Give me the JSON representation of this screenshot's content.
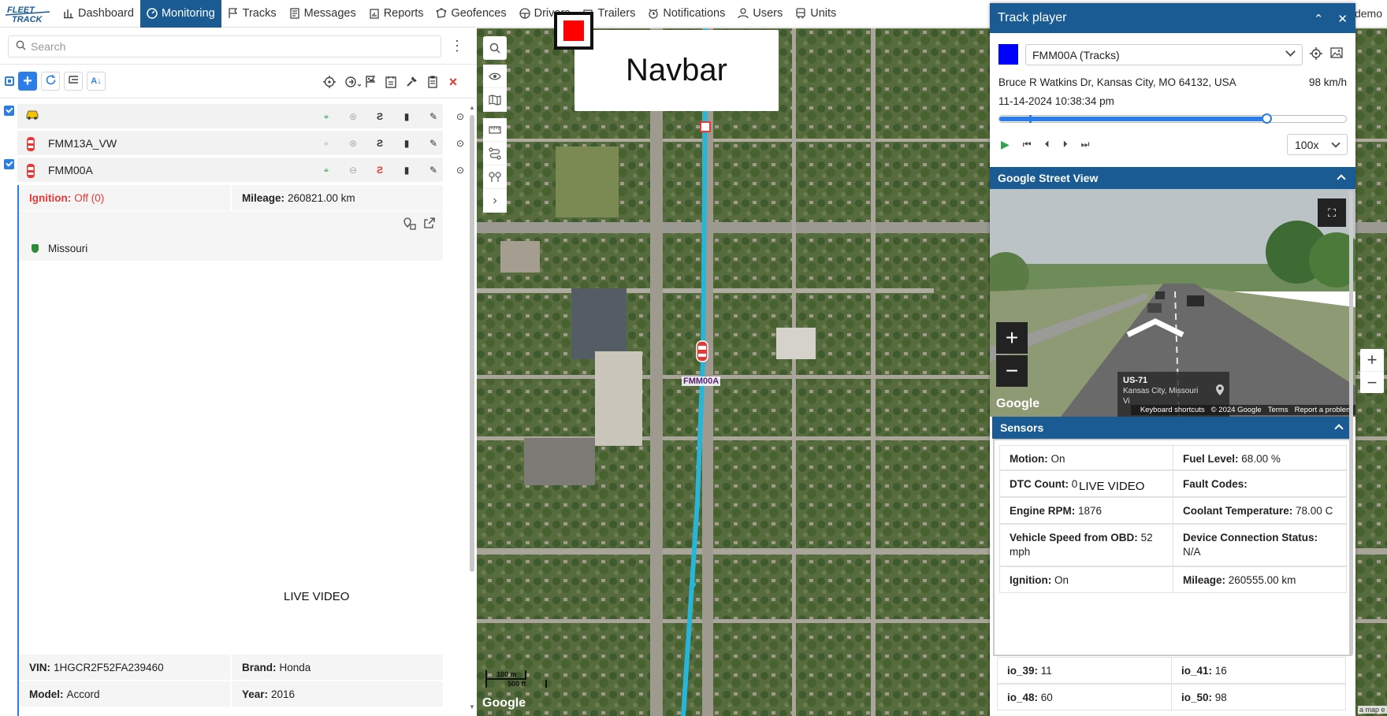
{
  "navbar": {
    "items": [
      {
        "label": "Dashboard",
        "icon": "bar-chart-icon"
      },
      {
        "label": "Monitoring",
        "icon": "gauge-icon",
        "active": true
      },
      {
        "label": "Tracks",
        "icon": "flag-icon"
      },
      {
        "label": "Messages",
        "icon": "document-icon"
      },
      {
        "label": "Reports",
        "icon": "report-icon"
      },
      {
        "label": "Geofences",
        "icon": "geofence-icon"
      },
      {
        "label": "Drivers",
        "icon": "steering-wheel-icon"
      },
      {
        "label": "Trailers",
        "icon": "trailer-icon"
      },
      {
        "label": "Notifications",
        "icon": "alarm-icon"
      },
      {
        "label": "Users",
        "icon": "user-icon"
      },
      {
        "label": "Units",
        "icon": "bus-icon"
      }
    ],
    "user": "_demo",
    "active_color": "#1a5b94"
  },
  "search": {
    "placeholder": "Search"
  },
  "units": [
    {
      "name": "",
      "checked": true,
      "icon": "taxi-icon"
    },
    {
      "name": "FMM13A_VW",
      "checked": false,
      "icon": "car-icon"
    },
    {
      "name": "FMM00A",
      "checked": true,
      "icon": "car-icon"
    }
  ],
  "unit_details": {
    "ignition_label": "Ignition:",
    "ignition_value": "Off (0)",
    "mileage_label": "Mileage:",
    "mileage_value": "260821.00 km",
    "geofence": "Missouri",
    "vin_label": "VIN:",
    "vin_value": "1HGCR2F52FA239460",
    "brand_label": "Brand:",
    "brand_value": "Honda",
    "model_label": "Model:",
    "model_value": "Accord",
    "year_label": "Year:",
    "year_value": "2016"
  },
  "live_video_left": "LIVE VIDEO",
  "map": {
    "navbar_overlay": "Navbar",
    "car_label": "FMM00A",
    "google": "Google",
    "scale_m": "100 m",
    "scale_ft": "500 ft",
    "map_data_link": "a map e"
  },
  "track_player": {
    "title": "Track player",
    "unit_select": "FMM00A (Tracks)",
    "track_color": "#0000ff",
    "address": "Bruce R Watkins Dr, Kansas City, MO 64132, USA",
    "speed": "98 km/h",
    "timestamp": "11-14-2024 10:38:34 pm",
    "progress": 0.77,
    "playback_speed": "100x"
  },
  "street_view": {
    "title": "Google Street View",
    "road": "US-71",
    "location": "Kansas City, Missouri",
    "location_trunc": "Vi",
    "google": "Google",
    "footer": [
      "Keyboard shortcuts",
      "© 2024 Google",
      "Terms",
      "Report a problem"
    ]
  },
  "sensors": {
    "title": "Sensors",
    "rows": [
      [
        {
          "label": "Motion:",
          "value": "On"
        },
        {
          "label": "Fuel Level:",
          "value": "68.00 %"
        }
      ],
      [
        {
          "label": "DTC Count:",
          "value": "0"
        },
        {
          "label": "Fault Codes:",
          "value": ""
        }
      ],
      [
        {
          "label": "Engine RPM:",
          "value": "1876"
        },
        {
          "label": "Coolant Temperature:",
          "value": "78.00 C"
        }
      ],
      [
        {
          "label": "Vehicle Speed from OBD:",
          "value": "52 mph"
        },
        {
          "label": "Device Connection Status:",
          "value": "N/A"
        }
      ],
      [
        {
          "label": "Ignition:",
          "value": "On"
        },
        {
          "label": "Mileage:",
          "value": "260555.00 km"
        }
      ]
    ],
    "io_rows": [
      [
        {
          "label": "io_39:",
          "value": "11"
        },
        {
          "label": "io_41:",
          "value": "16"
        }
      ],
      [
        {
          "label": "io_48:",
          "value": "60"
        },
        {
          "label": "io_50:",
          "value": "98"
        }
      ]
    ]
  },
  "live_video_right": "LIVE VIDEO"
}
